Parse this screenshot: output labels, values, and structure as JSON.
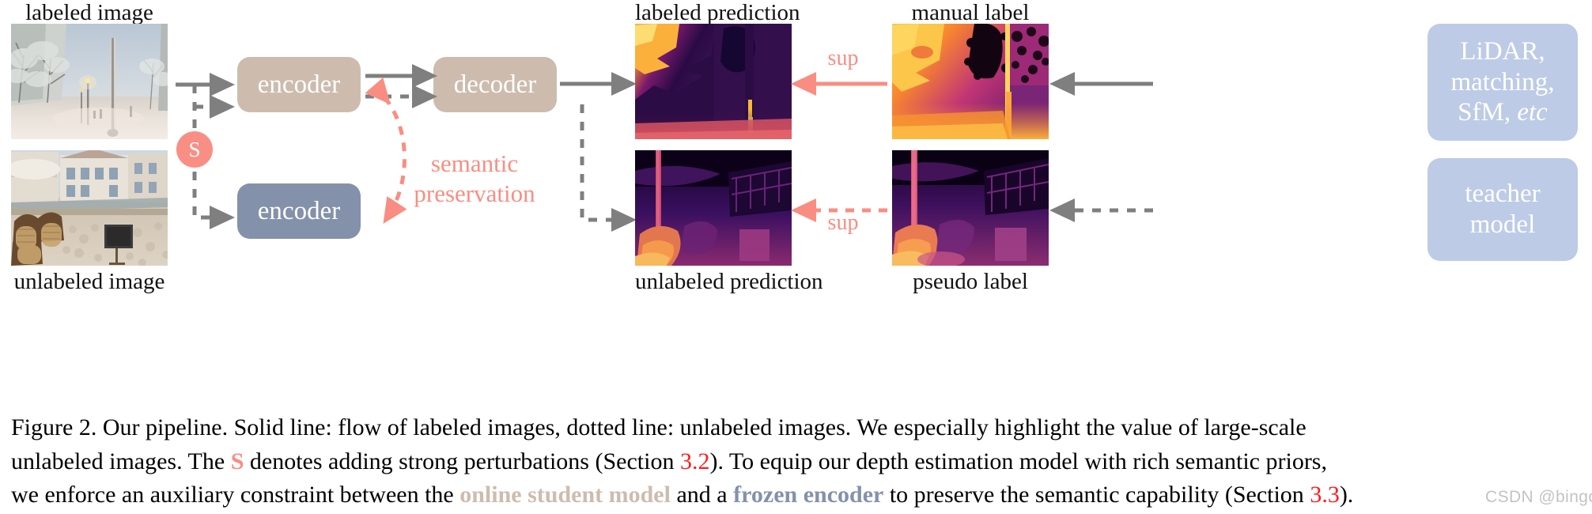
{
  "figure": {
    "id": "Figure 2",
    "labels": {
      "labeled_image": "labeled image",
      "unlabeled_image": "unlabeled image",
      "labeled_prediction": "labeled prediction",
      "unlabeled_prediction": "unlabeled prediction",
      "manual_label": "manual label",
      "pseudo_label": "pseudo label"
    },
    "nodes": {
      "encoder_student": "encoder",
      "encoder_frozen": "encoder",
      "decoder": "decoder",
      "perturbation": "S",
      "label_sources": "LiDAR,\nmatching,\nSfM, etc",
      "label_sources_line1": "LiDAR,",
      "label_sources_line2": "matching,",
      "label_sources_line3a": "SfM,",
      "label_sources_line3b": "etc",
      "teacher_line1": "teacher",
      "teacher_line2": "model"
    },
    "edge_labels": {
      "semantic_line1": "semantic",
      "semantic_line2": "preservation",
      "sup_top": "sup",
      "sup_bottom": "sup"
    },
    "colors": {
      "tan_box": "#cdbcae",
      "blue_box": "#8491ab",
      "light_blue_box": "#bdcbe6",
      "pink_accent": "#fa8d82",
      "arrow_gray": "#7f7f7f",
      "caption_red": "#ff1c1c"
    }
  },
  "caption": {
    "p1": "Figure 2. Our pipeline. Solid line: flow of labeled images, dotted line: unlabeled images. We especially highlight the value of large-scale",
    "l2_a": "unlabeled images. The ",
    "l2_s": "S",
    "l2_b": " denotes adding strong perturbations (Section ",
    "l2_sec": "3.2",
    "l2_c": "). To equip our depth estimation model with rich semantic priors,",
    "l3_a": "we enforce an auxiliary constraint between the ",
    "l3_student": "online student model",
    "l3_b": " and a ",
    "l3_frozen": "frozen encoder",
    "l3_c": " to preserve the semantic capability (Section ",
    "l3_sec": "3.3",
    "l3_d": ")."
  },
  "watermark": {
    "text": "CSDN @bingo阔"
  }
}
